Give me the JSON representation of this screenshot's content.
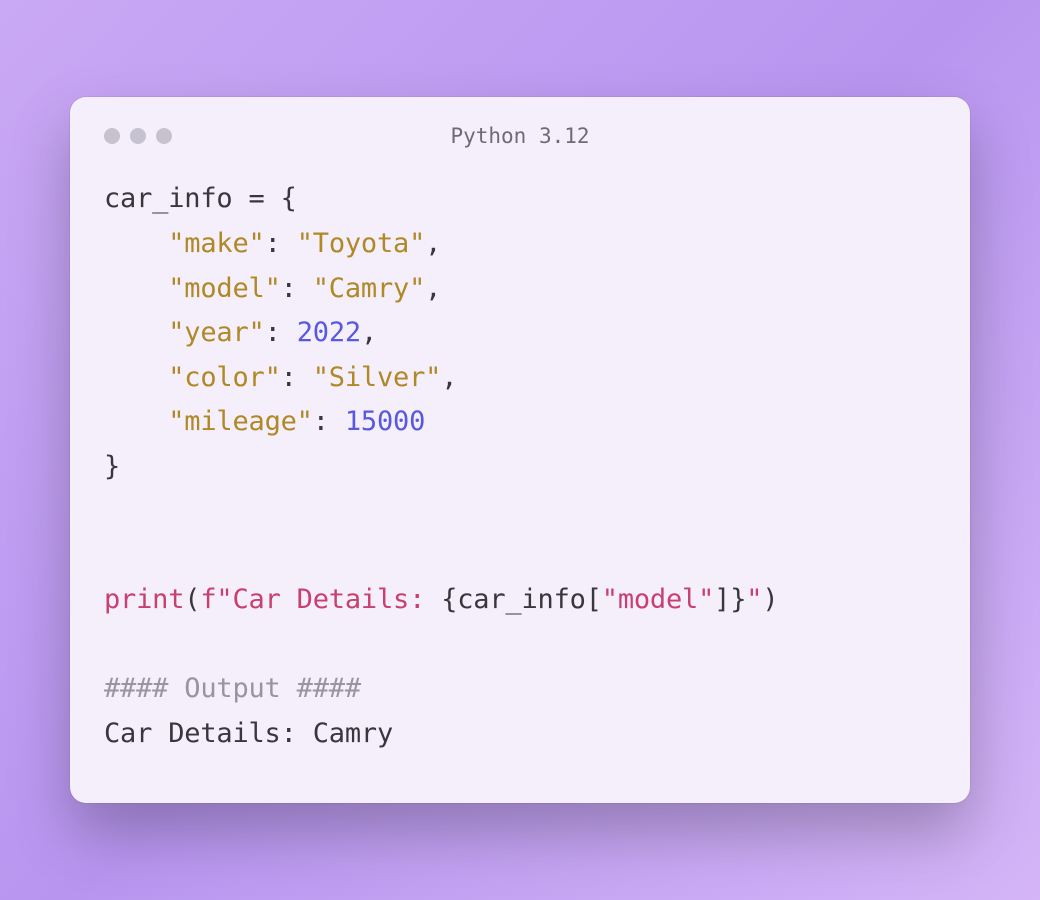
{
  "window": {
    "title": "Python 3.12"
  },
  "code": {
    "line1": {
      "var": "car_info",
      "eq_open": " = {"
    },
    "entries": [
      {
        "indent": "    ",
        "key": "\"make\"",
        "colon": ": ",
        "val": "\"Toyota\"",
        "type": "string",
        "trail": ","
      },
      {
        "indent": "    ",
        "key": "\"model\"",
        "colon": ": ",
        "val": "\"Camry\"",
        "type": "string",
        "trail": ","
      },
      {
        "indent": "    ",
        "key": "\"year\"",
        "colon": ": ",
        "val": "2022",
        "type": "number",
        "trail": ","
      },
      {
        "indent": "    ",
        "key": "\"color\"",
        "colon": ": ",
        "val": "\"Silver\"",
        "type": "string",
        "trail": ","
      },
      {
        "indent": "    ",
        "key": "\"mileage\"",
        "colon": ": ",
        "val": "15000",
        "type": "number",
        "trail": ""
      }
    ],
    "close_brace": "}",
    "blank": "",
    "print_line": {
      "func": "print",
      "open_paren": "(",
      "f_prefix": "f\"Car Details: ",
      "inter_open": "{",
      "expr_name": "car_info",
      "expr_bracket_open": "[",
      "expr_key": "\"model\"",
      "expr_bracket_close": "]",
      "inter_close": "}",
      "f_suffix": "\"",
      "close_paren": ")"
    },
    "output_header": "#### Output ####",
    "output_line": "Car Details: Camry"
  }
}
